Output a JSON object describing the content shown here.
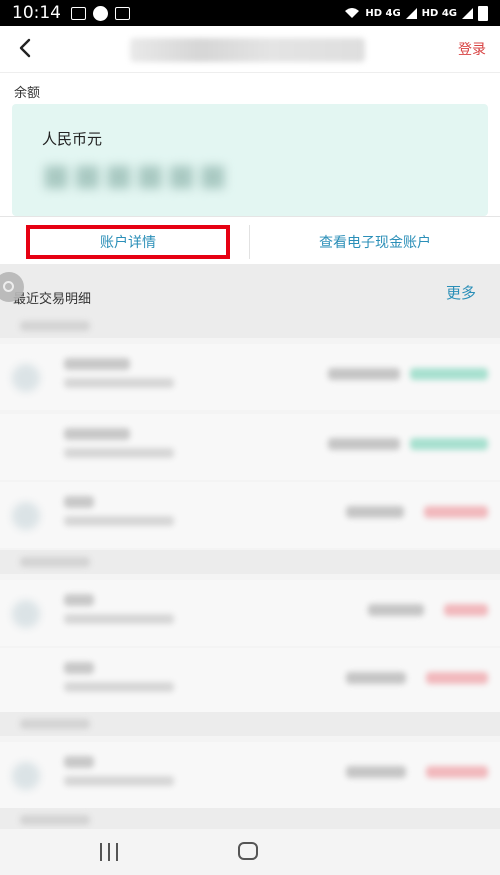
{
  "status_bar": {
    "time": "10:14",
    "network_left": "HD 4G",
    "network_right": "HD 4G"
  },
  "header": {
    "login_label": "登录"
  },
  "balance": {
    "label": "余额",
    "currency": "人民币元"
  },
  "actions": {
    "account_detail": "账户详情",
    "view_ecash": "查看电子现金账户"
  },
  "recent": {
    "title": "最近交易明细",
    "more": "更多"
  },
  "colors": {
    "accent": "#2b8fb8",
    "highlight_border": "#e60012",
    "login": "#d84444",
    "card_bg": "#e3f6f2"
  },
  "icons": [
    "back-icon",
    "image-icon",
    "browser-icon",
    "sim-icon",
    "wifi-icon",
    "signal-icon",
    "battery-icon",
    "recents-icon",
    "home-icon"
  ]
}
